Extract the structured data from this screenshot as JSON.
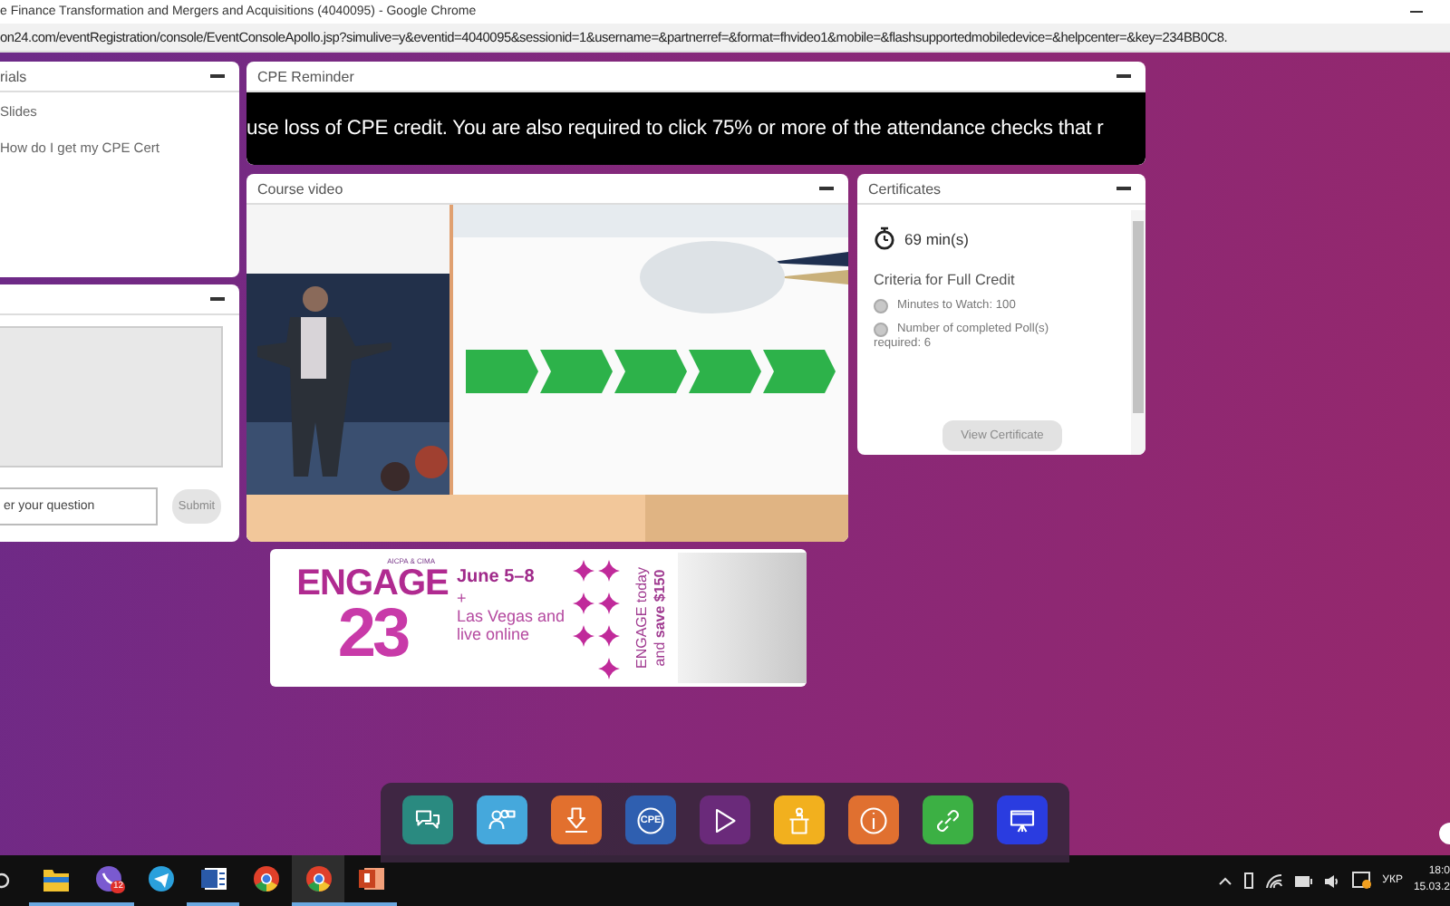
{
  "window": {
    "title": "e Finance Transformation and Mergers and Acquisitions (4040095) - Google Chrome",
    "url": "on24.com/eventRegistration/console/EventConsoleApollo.jsp?simulive=y&eventid=4040095&sessionid=1&username=&partnerref=&format=fhvideo1&mobile=&flashsupportedmobiledevice=&helpcenter=&key=234BB0C8."
  },
  "materials": {
    "title": "rials",
    "items": [
      "Slides",
      "How do I get my CPE Cert"
    ]
  },
  "qa": {
    "placeholder": "er your question",
    "submit": {
      "label": "Submit",
      "disabled": true
    }
  },
  "reminder": {
    "title": "CPE Reminder",
    "ticker": "use loss of CPE credit. You are also required to click 75% or more of the attendance checks that r"
  },
  "video": {
    "title": "Course video"
  },
  "certificates": {
    "title": "Certificates",
    "time": "69 min(s)",
    "criteria_title": "Criteria for Full Credit",
    "criteria": [
      {
        "label": "Minutes to Watch: 100",
        "completed": false
      },
      {
        "label": "Number of completed Poll(s) required: 6",
        "completed": false
      }
    ],
    "button": {
      "label": "View Certificate",
      "disabled": true
    }
  },
  "ad": {
    "org": "AICPA & CIMA",
    "brand": "ENGAGE",
    "year": "23",
    "dates": "June 5–8",
    "plus": "+",
    "place": "Las Vegas and live online",
    "offer": [
      "ENGAGE today",
      "and **save $150**"
    ]
  },
  "dock": [
    {
      "kind": "chat",
      "color": "#2a8a80"
    },
    {
      "kind": "people",
      "color": "#45a8dc"
    },
    {
      "kind": "download",
      "color": "#e2702e"
    },
    {
      "kind": "cpe",
      "color": "#2f5fb0",
      "label": "CPE"
    },
    {
      "kind": "play",
      "color": "#6a2a7a"
    },
    {
      "kind": "podium",
      "color": "#f2b01e"
    },
    {
      "kind": "info",
      "color": "#e07030"
    },
    {
      "kind": "link",
      "color": "#3cb044"
    },
    {
      "kind": "presentation",
      "color": "#2a3ce0"
    }
  ],
  "taskbar": {
    "apps": [
      {
        "kind": "folder",
        "running": true,
        "selected": false
      },
      {
        "kind": "viber",
        "running": true,
        "selected": false,
        "badge": "12"
      },
      {
        "kind": "telegram",
        "running": false,
        "selected": false
      },
      {
        "kind": "word",
        "running": true,
        "selected": false
      },
      {
        "kind": "chrome",
        "running": false,
        "selected": false
      },
      {
        "kind": "chrome",
        "running": true,
        "selected": true
      },
      {
        "kind": "powerpoint",
        "running": true,
        "selected": false
      }
    ],
    "language": "УКР",
    "time": "18:0",
    "date": "15.03.2"
  }
}
